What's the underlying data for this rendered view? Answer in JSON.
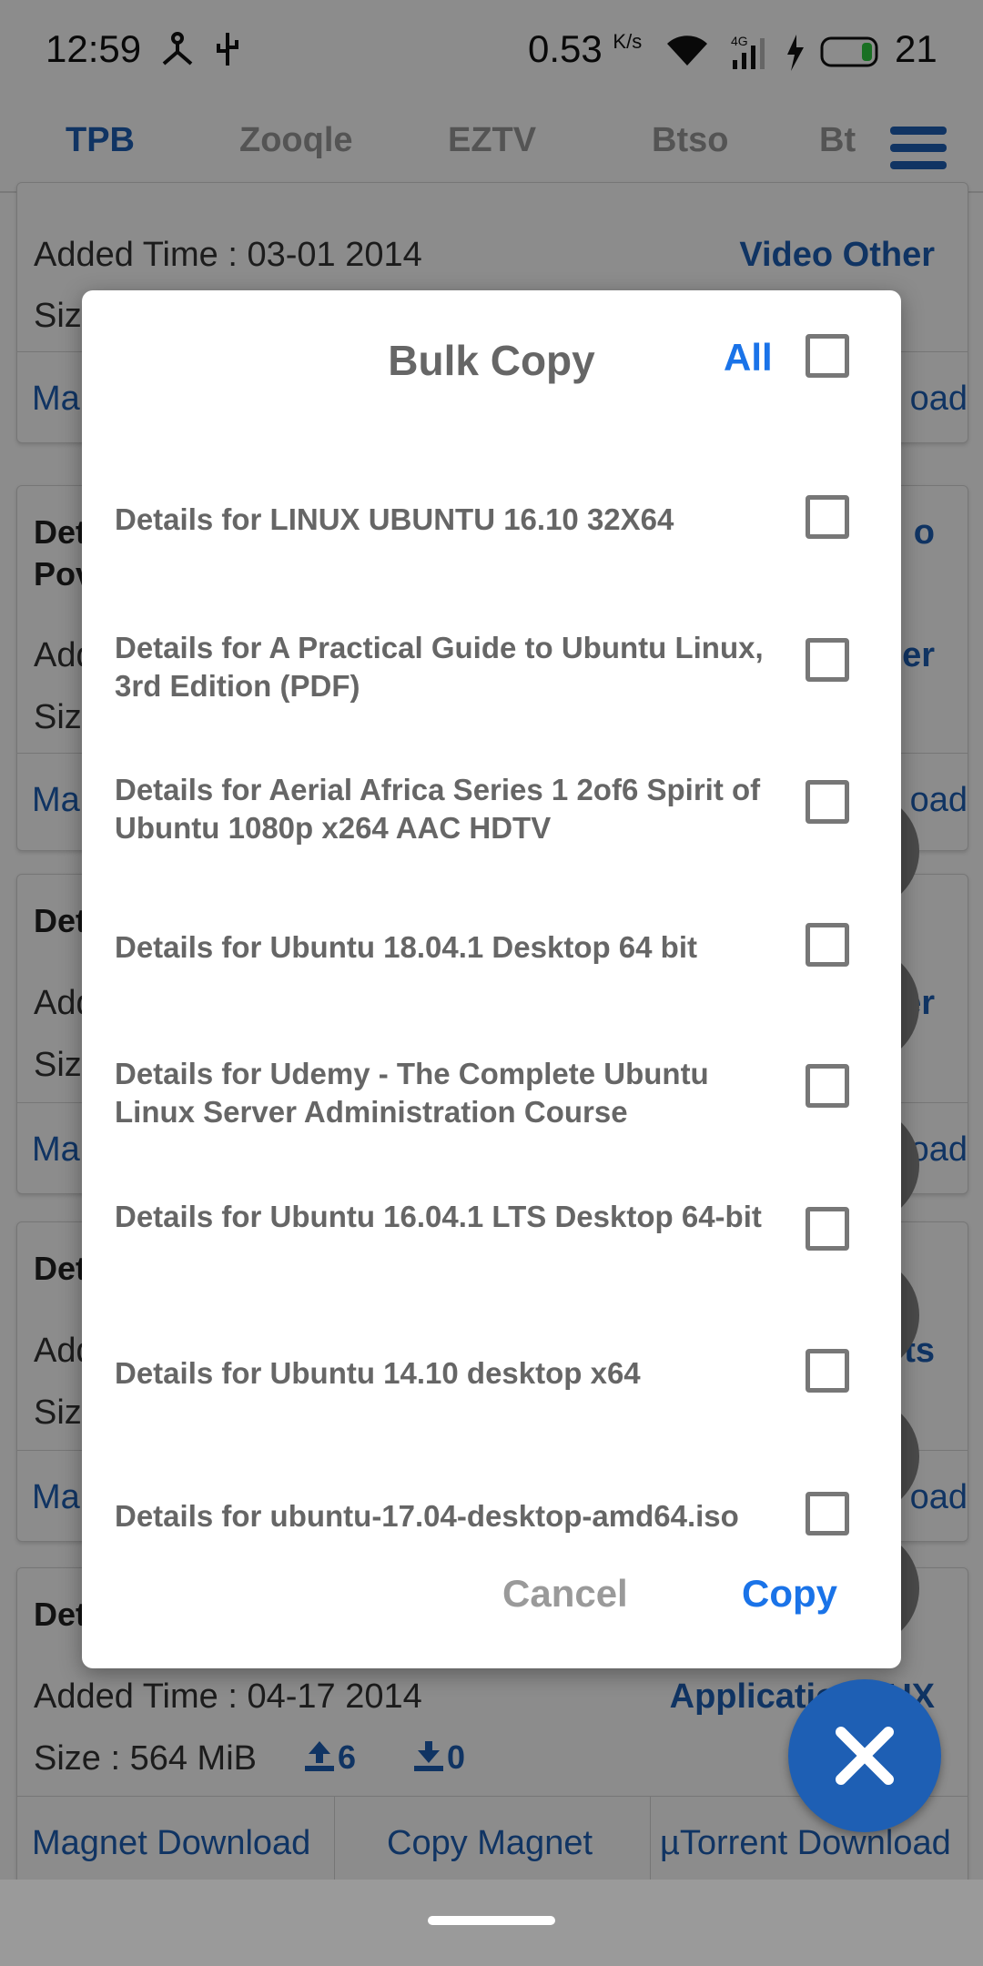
{
  "status": {
    "time": "12:59",
    "speed": "0.53",
    "speed_unit": "K/s",
    "battery": "21"
  },
  "tabs": [
    "TPB",
    "Zooqle",
    "EZTV",
    "Btso",
    "Bt"
  ],
  "background": {
    "card1": {
      "added": "Added Time :  03-01 2014",
      "size_prefix": "Siz",
      "category": "Video Other",
      "magnet_short": "Ma",
      "download_short": "oad"
    },
    "card2": {
      "title_a": "Det",
      "title_b": "Pov",
      "added_short": "Add",
      "size_prefix": "Siz",
      "cat_short_a": "o",
      "cat_short_b": "er",
      "magnet_short": "Ma",
      "download_short": "oad"
    },
    "card3": {
      "title_a": "Det",
      "added_short": "Add",
      "size_prefix": "Siz",
      "cat_short": "er",
      "magnet_short": "Ma",
      "download_short": "oad"
    },
    "card4": {
      "title_a": "Det",
      "added_short": "Add",
      "size_prefix": "Siz",
      "cat_short": "ts",
      "magnet_short": "Ma",
      "download_short": "oad"
    },
    "card5": {
      "title_a": "Det",
      "added": "Added Time :  04-17 2014",
      "category": "Applications UX",
      "size": "Size :  564 MiB",
      "seeders": "6",
      "leechers": "0",
      "magnet_download": "Magnet Download",
      "copy_magnet": "Copy Magnet",
      "utorrent_download": "µTorrent Download"
    }
  },
  "dialog": {
    "title": "Bulk Copy",
    "all_label": "All",
    "items": [
      "Details for LINUX UBUNTU 16.10 32X64",
      "Details for A Practical Guide to Ubuntu Linux, 3rd Edition (PDF)",
      "Details for Aerial Africa Series 1 2of6 Spirit of Ubuntu 1080p x264 AAC HDTV",
      "Details for Ubuntu 18.04.1 Desktop 64 bit",
      "Details for Udemy - The Complete Ubuntu Linux Server Administration Course",
      "Details for Ubuntu 16.04.1 LTS Desktop 64-bit",
      "Details for Ubuntu 14.10 desktop  x64",
      "Details for ubuntu-17.04-desktop-amd64.iso"
    ],
    "cancel_label": "Cancel",
    "copy_label": "Copy"
  },
  "colors": {
    "accent": "#1a73e8",
    "brand": "#1e5fb4"
  }
}
